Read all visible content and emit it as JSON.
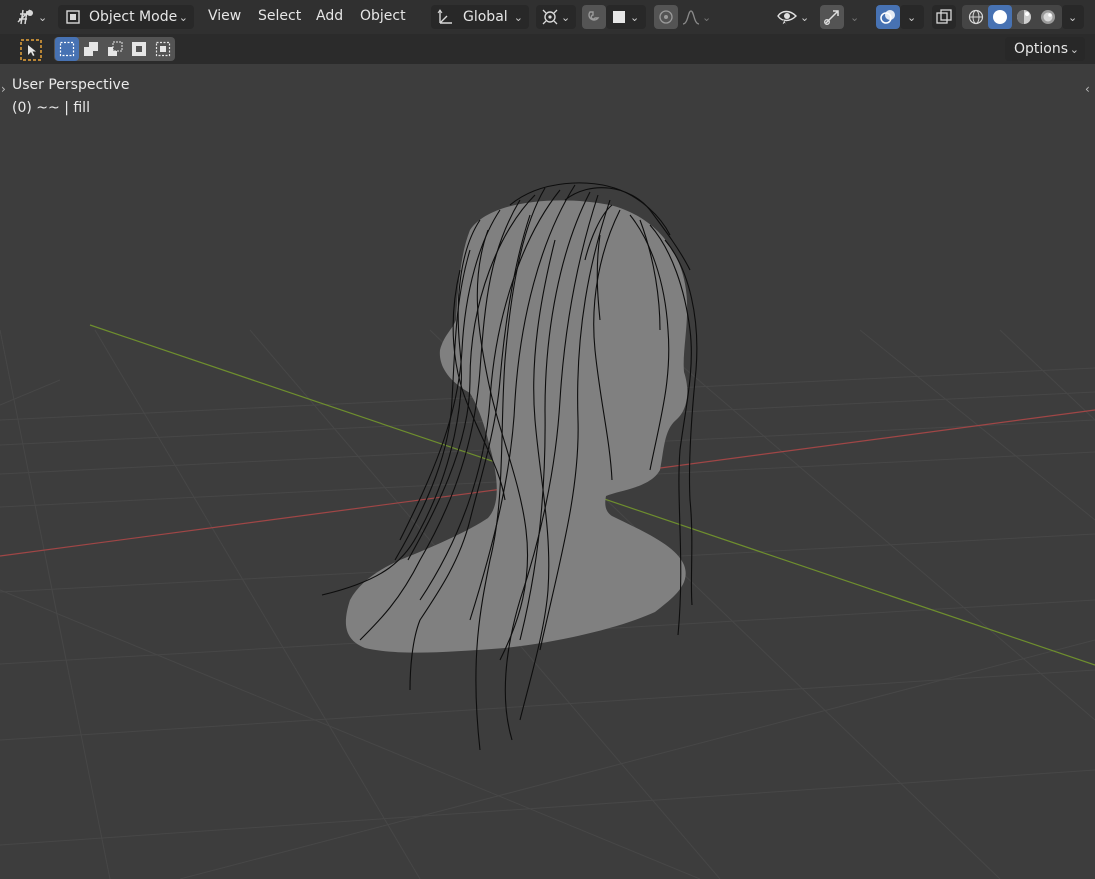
{
  "header": {
    "editor_type_icon": "grease-pencil-editor-icon",
    "mode": {
      "icon": "object-mode-icon",
      "label": "Object Mode"
    },
    "menus": [
      {
        "label": "View"
      },
      {
        "label": "Select"
      },
      {
        "label": "Add"
      },
      {
        "label": "Object"
      }
    ],
    "orientation": {
      "icon": "transform-orientation-icon",
      "label": "Global"
    },
    "pivot_icon": "pivot-point-icon",
    "snap_icon": "snap-magnet-icon",
    "snap_target_icon": "snap-increment-icon",
    "proportional_icon": "proportional-editing-icon",
    "falloff_icon": "falloff-curve-icon",
    "visibility_icon": "selectability-visibility-icon",
    "gizmo_icon": "gizmo-icon",
    "overlays_icon": "overlays-icon",
    "xray_icon": "xray-icon",
    "shading_modes": [
      {
        "name": "wireframe",
        "icon": "wireframe-shading-icon",
        "active": false
      },
      {
        "name": "solid",
        "icon": "solid-shading-icon",
        "active": true
      },
      {
        "name": "material",
        "icon": "material-preview-icon",
        "active": false
      },
      {
        "name": "rendered",
        "icon": "rendered-shading-icon",
        "active": false
      }
    ]
  },
  "toolbar": {
    "select_tool_icon": "select-tool-icon",
    "selection_modes": [
      {
        "icon": "select-new-icon",
        "active": true
      },
      {
        "icon": "select-extend-icon",
        "active": false
      },
      {
        "icon": "select-subtract-icon",
        "active": false
      },
      {
        "icon": "select-invert-icon",
        "active": false
      },
      {
        "icon": "select-intersect-icon",
        "active": false
      }
    ],
    "options_label": "Options"
  },
  "viewport": {
    "perspective_label": "User Perspective",
    "object_label": "(0) ~~ | fill",
    "axis_colors": {
      "x": "#a04646",
      "y": "#6e8e2e"
    },
    "mesh_color": "#808080",
    "stroke_color": "#0d0d0d"
  }
}
